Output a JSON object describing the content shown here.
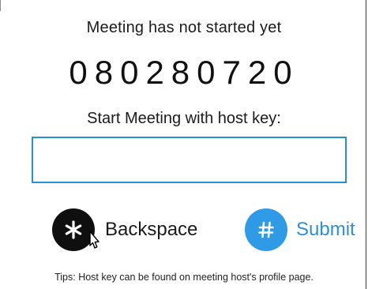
{
  "meeting": {
    "status_text": "Meeting has not started yet",
    "meeting_id": "080280720",
    "prompt": "Start Meeting with host key:"
  },
  "host_key_input": {
    "value": "",
    "placeholder": ""
  },
  "actions": {
    "backspace": {
      "icon": "asterisk-icon",
      "glyph": "*",
      "label": "Backspace",
      "color": "#0f0f0f"
    },
    "submit": {
      "icon": "hash-icon",
      "glyph": "#",
      "label": "Submit",
      "color": "#2f9be6"
    }
  },
  "tips": "Tips: Host key can be found on meeting host's profile page.",
  "colors": {
    "accent": "#2f9be6",
    "input_border": "#2b8fd6",
    "text": "#1b1b1b"
  }
}
